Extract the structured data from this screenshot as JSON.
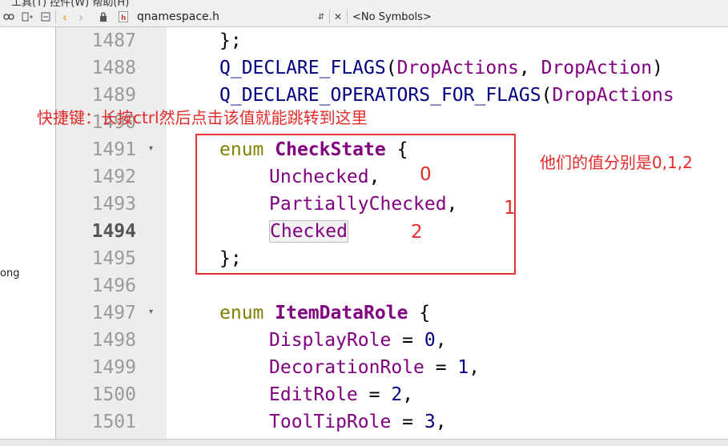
{
  "menu": {
    "partial_text": "工具(T)   控件(W)   帮助(H)"
  },
  "toolbar": {
    "file_name": "qnamespace.h",
    "symbols": "<No Symbols>"
  },
  "sidebar": {
    "partial_text": "ong"
  },
  "gutter": {
    "lines": [
      "1487",
      "1488",
      "1489",
      "1490",
      "1491",
      "1492",
      "1493",
      "1494",
      "1495",
      "1496",
      "1497",
      "1498",
      "1499",
      "1500",
      "1501"
    ],
    "current_line": "1494"
  },
  "code": {
    "l1487": "};",
    "l1488_macro": "Q_DECLARE_FLAGS",
    "l1488_arg1": "DropActions",
    "l1488_arg2": "DropAction",
    "l1489_macro": "Q_DECLARE_OPERATORS_FOR_FLAGS",
    "l1489_arg1": "DropActions",
    "enum_kw": "enum",
    "enum1_name": "CheckState",
    "e1": "Unchecked",
    "e2": "PartiallyChecked",
    "e3": "Checked",
    "close": "};",
    "enum2_name": "ItemDataRole",
    "r1": "DisplayRole",
    "r1v": "0",
    "r2": "DecorationRole",
    "r2v": "1",
    "r3": "EditRole",
    "r3v": "2",
    "r4": "ToolTipRole",
    "r4v": "3"
  },
  "annotations": {
    "shortcut_note": "快捷键：长按ctrl然后点击该值就能跳转到这里",
    "values_note": "他们的值分别是0,1,2",
    "label0": "0",
    "label1": "1",
    "label2": "2"
  },
  "colors": {
    "annotation_red": "#e53333",
    "keyword": "#808000",
    "type_name": "#800080",
    "macro": "#000080"
  }
}
